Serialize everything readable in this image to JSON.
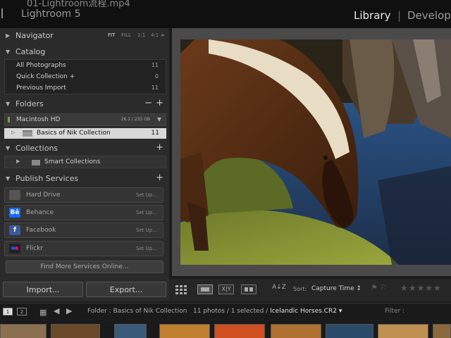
{
  "window": {
    "video_title": "01-Lightroom流程.mp4",
    "app_name": "Lightroom 5",
    "modules": [
      "Library",
      "Develop"
    ],
    "module_separator": "|"
  },
  "navigator": {
    "title": "Navigator",
    "zoom_options": [
      "FIT",
      "FILL",
      "1:1",
      "4:1"
    ],
    "active_zoom": "FIT"
  },
  "catalog": {
    "title": "Catalog",
    "items": [
      {
        "label": "All Photographs",
        "count": "11"
      },
      {
        "label": "Quick Collection +",
        "count": "0"
      },
      {
        "label": "Previous Import",
        "count": "11"
      }
    ]
  },
  "folders": {
    "title": "Folders",
    "volume": {
      "label": "Macintosh HD",
      "size": "26.1 / 233 GB"
    },
    "items": [
      {
        "label": "Basics of Nik Collection",
        "count": "11"
      }
    ]
  },
  "collections": {
    "title": "Collections",
    "items": [
      {
        "label": "Smart Collections"
      }
    ]
  },
  "publish": {
    "title": "Publish Services",
    "services": [
      {
        "label": "Hard Drive",
        "action": "Set Up...",
        "icon": "hard-drive-icon"
      },
      {
        "label": "Behance",
        "action": "Set Up...",
        "icon": "behance-icon",
        "icon_text": "Bē"
      },
      {
        "label": "Facebook",
        "action": "Set Up...",
        "icon": "facebook-icon",
        "icon_text": "f"
      },
      {
        "label": "Flickr",
        "action": "Set Up...",
        "icon": "flickr-icon"
      }
    ],
    "find_more": "Find More Services Online..."
  },
  "buttons": {
    "import": "Import...",
    "export": "Export..."
  },
  "toolbar": {
    "sort_label": "Sort:",
    "sort_value": "Capture Time ↕",
    "az_label": "A↓Z"
  },
  "filmstrip": {
    "monitor_1": "1",
    "monitor_2": "2",
    "source_path": "Folder : Basics of Nik Collection",
    "count_text": "11 photos / 1 selected /",
    "selected_file": "Icelandic Horses.CR2 ▾",
    "filter_label": "Filter :"
  },
  "colors": {
    "panel_bg": "#2b2b2b",
    "app_bg": "#1c1c1c",
    "selected_row": "#d8d8d8",
    "behance": "#1769ff",
    "facebook": "#3b5998"
  }
}
